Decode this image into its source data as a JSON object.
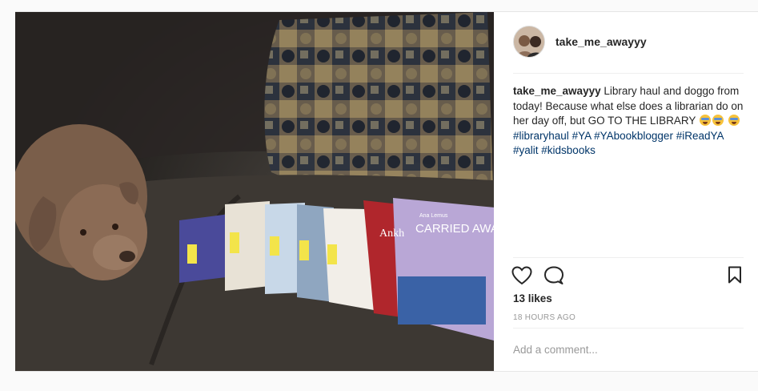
{
  "post": {
    "username": "take_me_awayyy",
    "caption": {
      "username": "take_me_awayyy",
      "text": "Library haul and doggo from today! Because what else does a librarian do on her day off, but GO TO THE LIBRARY",
      "hashtags": [
        "#libraryhaul",
        "#YA",
        "#YAbookblogger",
        "#iReadYA",
        "#yalit",
        "#kidsbooks"
      ]
    },
    "likes": "13 likes",
    "timestamp": "18 HOURS AGO",
    "comment_placeholder": "Add a comment...",
    "book_covers": {
      "left_book_title": "CARRIED AWAY",
      "left_book_author": "Ana Lemus",
      "ankle_book_title": "Ankh"
    }
  },
  "icons": {
    "like": "heart-outline-icon",
    "comment": "speech-bubble-icon",
    "save": "bookmark-icon",
    "emoji": "star-struck-face-emoji"
  },
  "colors": {
    "hashtag": "#003569",
    "text": "#262626",
    "muted": "#999999",
    "divider": "#efefef"
  }
}
